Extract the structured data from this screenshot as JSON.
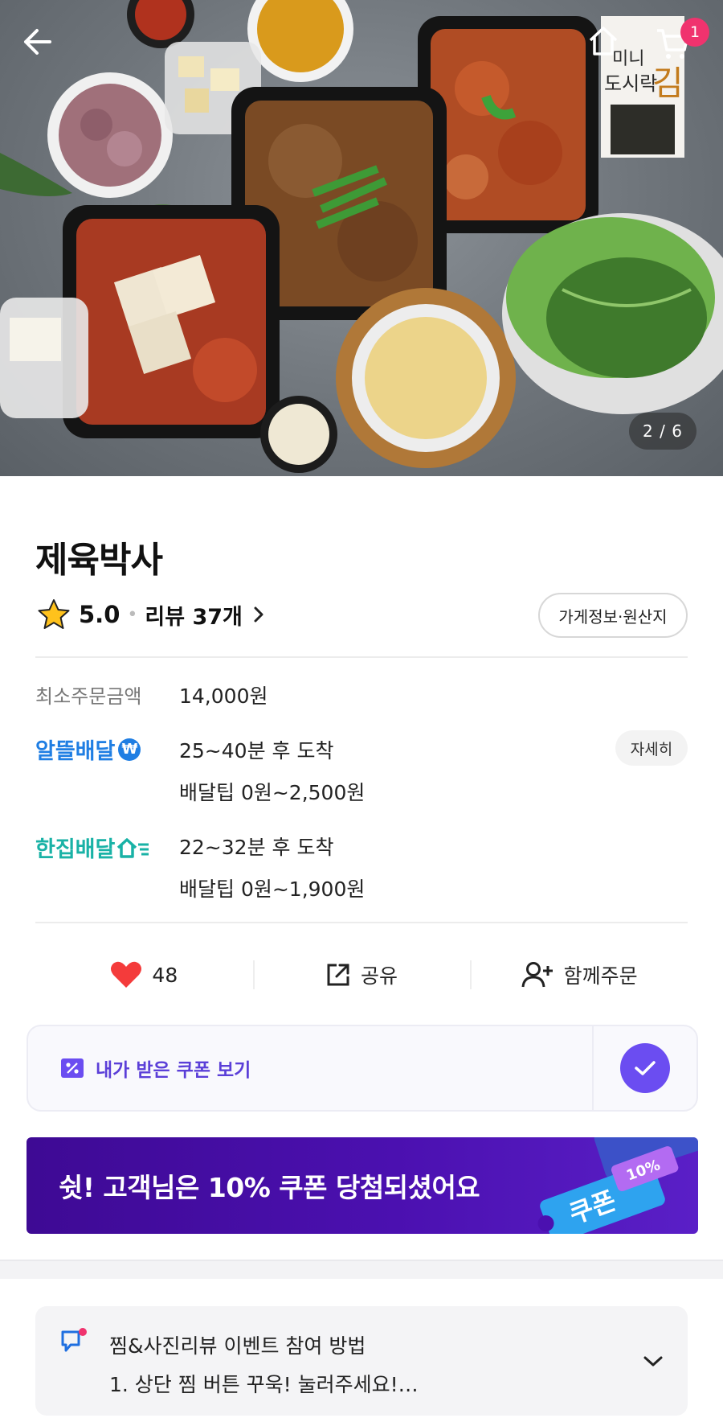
{
  "hero": {
    "page_indicator": "2 / 6",
    "cart_count": "1",
    "package_label_top": "미니",
    "package_label_main": "도시락",
    "package_label_big": "김"
  },
  "store": {
    "name": "제육박사",
    "rating": "5.0",
    "review_label": "리뷰 37개",
    "info_button": "가게정보·원산지"
  },
  "delivery": {
    "min_order_label": "최소주문금액",
    "min_order_value": "14,000원",
    "economy": {
      "brand": "알뜰배달",
      "brand_icon": "₩",
      "eta": "25~40분 후 도착",
      "tip": "배달팁 0원~2,500원",
      "detail_button": "자세히"
    },
    "single": {
      "brand": "한집배달",
      "eta": "22~32분 후 도착",
      "tip": "배달팁 0원~1,900원"
    }
  },
  "actions": {
    "like_count": "48",
    "share_label": "공유",
    "group_order_label": "함께주문"
  },
  "coupon": {
    "view_label": "내가 받은 쿠폰 보기"
  },
  "banner": {
    "text": "쉿! 고객님은 10% 쿠폰 당첨되셨어요",
    "ticket_label": "쿠폰",
    "ticket_percent": "10%"
  },
  "notice": {
    "title": "찜&사진리뷰 이벤트 참여 방법",
    "subtitle": "1. 상단 찜 버튼 꾸욱! 눌러주세요!…"
  },
  "colors": {
    "accent_purple": "#6b4df1",
    "economy_blue": "#1f7ee3",
    "single_teal": "#19b2a6",
    "badge_pink": "#f0336e",
    "heart_red": "#f43b3b"
  },
  "icons": [
    "back-arrow-icon",
    "home-icon",
    "cart-icon",
    "star-icon",
    "chevron-right-icon",
    "won-icon",
    "house-arrow-icon",
    "heart-icon",
    "share-icon",
    "add-person-icon",
    "coupon-icon",
    "check-icon",
    "chat-icon",
    "chevron-down-icon"
  ]
}
